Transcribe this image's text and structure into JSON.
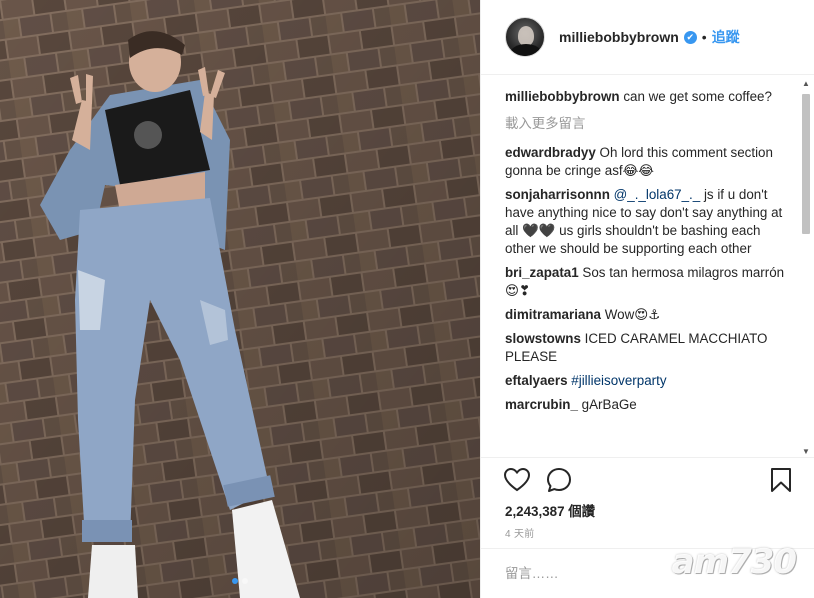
{
  "post": {
    "username": "milliebobbybrown",
    "separator": "•",
    "follow_label": "追蹤",
    "verified_mark": "✔"
  },
  "caption": {
    "user": "milliebobbybrown",
    "text": "can we get some coffee?"
  },
  "load_more_label": "載入更多留言",
  "comments": [
    {
      "user": "edwardbradyy",
      "pre": "Oh lord this comment section gonna be cringe asf😂😂",
      "mention": "",
      "post": ""
    },
    {
      "user": "sonjaharrisonnn",
      "pre": "",
      "mention": "@_._lola67_._",
      "post": " js if u don't have anything nice to say don't say anything at all 🖤🖤 us girls shouldn't be bashing each other we should be supporting each other"
    },
    {
      "user": "bri_zapata1",
      "pre": "Sos tan hermosa milagros marrón 😍❣",
      "mention": "",
      "post": ""
    },
    {
      "user": "dimitramariana",
      "pre": "Wow😍⚓",
      "mention": "",
      "post": ""
    },
    {
      "user": "slowstowns",
      "pre": "ICED CARAMEL MACCHIATO PLEASE",
      "mention": "",
      "post": ""
    },
    {
      "user": "eftalyaers",
      "pre": "",
      "mention": "#jillieisoverparty",
      "post": ""
    },
    {
      "user": "marcrubin_",
      "pre": "gArBaGe",
      "mention": "",
      "post": ""
    }
  ],
  "likes": "2,243,387 個讚",
  "time_ago": "4 天前",
  "add_comment_placeholder": "留言……",
  "watermark": "am730",
  "carousel": {
    "total": 2,
    "active": 1
  },
  "icons": {
    "like": "heart-icon",
    "comment": "comment-bubble-icon",
    "save": "bookmark-icon",
    "verified": "verified-badge-icon"
  },
  "colors": {
    "accent": "#3897f0",
    "text": "#262626",
    "muted": "#999999",
    "divider": "#efefef"
  }
}
